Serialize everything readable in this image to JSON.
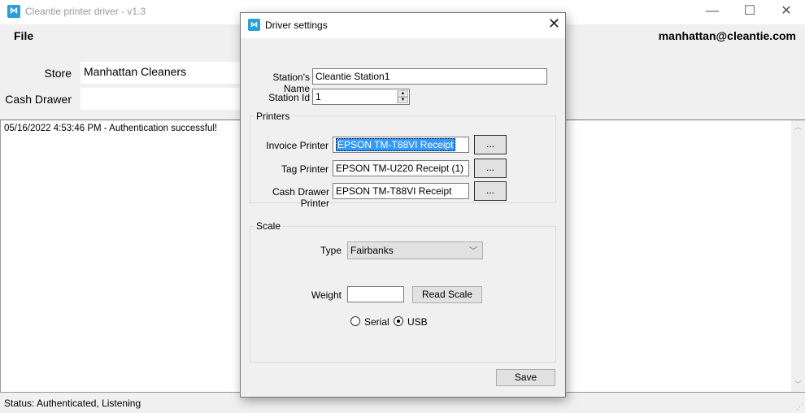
{
  "window": {
    "title": "Cleantie printer driver - v1.3",
    "icon": "app-logo-icon",
    "controls": {
      "minimize": "—",
      "maximize": "☐",
      "close": "✕"
    }
  },
  "menu": {
    "file_label": "File"
  },
  "user": {
    "email": "manhattan@cleantie.com"
  },
  "form": {
    "store_label": "Store",
    "store_value": "Manhattan Cleaners",
    "cash_drawer_label": "Cash Drawer",
    "cash_drawer_value": ""
  },
  "log": {
    "lines": [
      "05/16/2022 4:53:46 PM - Authentication successful!"
    ]
  },
  "status": {
    "text": "Status:  Authenticated, Listening"
  },
  "dialog": {
    "title": "Driver settings",
    "station_name_label": "Station's Name",
    "station_name_value": "Cleantie Station1",
    "station_id_label": "Station Id",
    "station_id_value": "1",
    "printers": {
      "group_label": "Printers",
      "invoice_label": "Invoice Printer",
      "invoice_value": "EPSON TM-T88VI Receipt",
      "tag_label": "Tag Printer",
      "tag_value": "EPSON TM-U220 Receipt (1)",
      "cash_drawer_label": "Cash Drawer Printer",
      "cash_drawer_value": "EPSON TM-T88VI Receipt",
      "browse_label": "..."
    },
    "scale": {
      "group_label": "Scale",
      "type_label": "Type",
      "type_value": "Fairbanks",
      "weight_label": "Weight",
      "weight_value": "",
      "read_scale_label": "Read Scale",
      "serial_label": "Serial",
      "usb_label": "USB",
      "selected_connection": "USB"
    },
    "save_label": "Save"
  }
}
